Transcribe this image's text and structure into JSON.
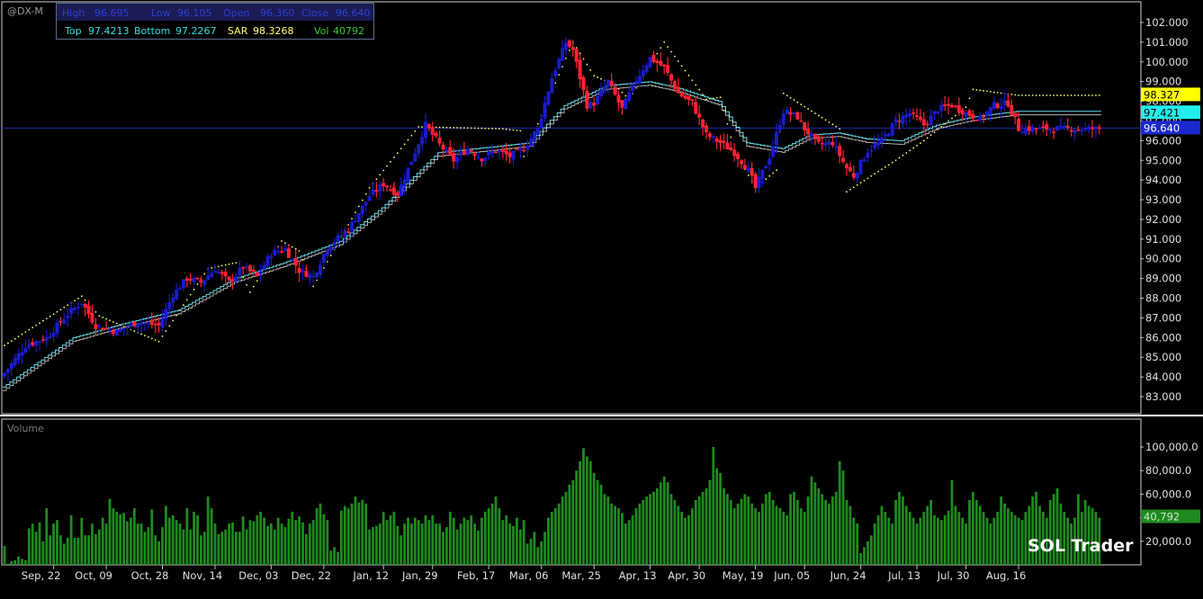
{
  "header": {
    "symbol": "@DX-M",
    "high_label": "High",
    "high_value": "96.695",
    "low_label": "Low",
    "low_value": "96.105",
    "open_label": "Open",
    "open_value": "96.360",
    "close_label": "Close",
    "close_value": "96.640",
    "top_label": "Top",
    "top_value": "97.4213",
    "bottom_label": "Bottom",
    "bottom_value": "97.2267",
    "sar_label": "SAR",
    "sar_value": "98.3268",
    "vol_label": "Vol",
    "vol_value": "40792"
  },
  "watermark": "SOL Trader",
  "colors": {
    "background": "#000000",
    "up_bar": "#1a1acc",
    "down_bar": "#ff2233",
    "band": "#66ddee",
    "sar": "#ffff66",
    "volume": "#1f8a1f",
    "price_line": "#1a2aaa"
  },
  "chart_data": [
    {
      "type": "candlestick",
      "name": "@DX-M",
      "ylim": [
        82.5,
        102.5
      ],
      "yticks": [
        "83.000",
        "84.000",
        "85.000",
        "86.000",
        "87.000",
        "88.000",
        "89.000",
        "90.000",
        "91.000",
        "92.000",
        "93.000",
        "94.000",
        "95.000",
        "96.000",
        "97.000",
        "98.000",
        "99.000",
        "100.000",
        "101.000",
        "102.000"
      ],
      "xticks": [
        "Sep, 22",
        "Oct, 09",
        "Oct, 28",
        "Nov, 14",
        "Dec, 03",
        "Dec, 22",
        "Jan, 12",
        "Jan, 29",
        "Feb, 17",
        "Mar, 06",
        "Mar, 25",
        "Apr, 13",
        "Apr, 30",
        "May, 19",
        "Jun, 05",
        "Jun, 24",
        "Jul, 13",
        "Jul, 30",
        "Aug, 16"
      ],
      "xtick_index": [
        14,
        29,
        45,
        60,
        76,
        91,
        108,
        122,
        138,
        153,
        168,
        184,
        198,
        214,
        228,
        244,
        260,
        274,
        289
      ],
      "last_price_label": "96.640",
      "sar_label": "98.327",
      "band_label": "97.421",
      "close_anchors": [
        [
          0,
          84.2
        ],
        [
          6,
          85.6
        ],
        [
          12,
          86.0
        ],
        [
          18,
          87.2
        ],
        [
          22,
          87.8
        ],
        [
          26,
          86.6
        ],
        [
          32,
          86.3
        ],
        [
          38,
          86.8
        ],
        [
          44,
          86.6
        ],
        [
          48,
          88.2
        ],
        [
          52,
          89.0
        ],
        [
          56,
          88.8
        ],
        [
          60,
          89.5
        ],
        [
          64,
          88.8
        ],
        [
          68,
          89.6
        ],
        [
          72,
          89.1
        ],
        [
          76,
          90.3
        ],
        [
          80,
          90.5
        ],
        [
          84,
          89.4
        ],
        [
          88,
          89.1
        ],
        [
          92,
          90.6
        ],
        [
          98,
          91.5
        ],
        [
          104,
          93.2
        ],
        [
          108,
          93.8
        ],
        [
          112,
          93.3
        ],
        [
          116,
          95.0
        ],
        [
          120,
          96.8
        ],
        [
          124,
          95.8
        ],
        [
          128,
          95.0
        ],
        [
          132,
          95.6
        ],
        [
          136,
          95.1
        ],
        [
          140,
          95.5
        ],
        [
          144,
          95.2
        ],
        [
          148,
          95.6
        ],
        [
          152,
          96.6
        ],
        [
          156,
          99.2
        ],
        [
          160,
          101.0
        ],
        [
          162,
          100.6
        ],
        [
          164,
          99.2
        ],
        [
          166,
          97.8
        ],
        [
          168,
          97.9
        ],
        [
          172,
          99.0
        ],
        [
          176,
          97.6
        ],
        [
          180,
          99.1
        ],
        [
          184,
          100.2
        ],
        [
          188,
          99.7
        ],
        [
          192,
          98.4
        ],
        [
          196,
          97.9
        ],
        [
          200,
          96.3
        ],
        [
          204,
          95.9
        ],
        [
          208,
          95.4
        ],
        [
          212,
          94.5
        ],
        [
          214,
          93.6
        ],
        [
          218,
          95.2
        ],
        [
          222,
          97.5
        ],
        [
          226,
          97.2
        ],
        [
          228,
          96.6
        ],
        [
          232,
          95.8
        ],
        [
          236,
          95.9
        ],
        [
          240,
          94.6
        ],
        [
          242,
          94.2
        ],
        [
          246,
          95.5
        ],
        [
          250,
          96.0
        ],
        [
          254,
          97.0
        ],
        [
          258,
          97.4
        ],
        [
          262,
          96.8
        ],
        [
          266,
          97.6
        ],
        [
          270,
          97.8
        ],
        [
          274,
          97.4
        ],
        [
          278,
          97.1
        ],
        [
          282,
          97.8
        ],
        [
          286,
          97.9
        ],
        [
          289,
          96.6
        ]
      ],
      "sar_anchors": [
        [
          0,
          85.6
        ],
        [
          22,
          88.1
        ],
        [
          27,
          87.1
        ],
        [
          40,
          86.1
        ],
        [
          44,
          85.8
        ],
        [
          58,
          89.5
        ],
        [
          66,
          89.8
        ],
        [
          70,
          88.3
        ],
        [
          79,
          90.9
        ],
        [
          84,
          90.4
        ],
        [
          88,
          88.6
        ],
        [
          104,
          93.6
        ],
        [
          118,
          96.7
        ],
        [
          142,
          96.6
        ],
        [
          147,
          96.5
        ],
        [
          148,
          95.2
        ],
        [
          162,
          101.0
        ],
        [
          168,
          99.3
        ],
        [
          174,
          98.8
        ],
        [
          178,
          98.1
        ],
        [
          188,
          101.0
        ],
        [
          200,
          98.1
        ],
        [
          204,
          98.2
        ],
        [
          208,
          95.5
        ],
        [
          214,
          93.6
        ],
        [
          220,
          94.5
        ],
        [
          222,
          98.4
        ],
        [
          238,
          96.6
        ],
        [
          240,
          93.4
        ],
        [
          254,
          95.0
        ],
        [
          262,
          96.0
        ],
        [
          274,
          97.7
        ],
        [
          276,
          98.6
        ],
        [
          289,
          98.3
        ]
      ],
      "band_anchors": [
        [
          0,
          83.4
        ],
        [
          20,
          85.9
        ],
        [
          34,
          86.6
        ],
        [
          50,
          87.3
        ],
        [
          66,
          88.9
        ],
        [
          80,
          89.7
        ],
        [
          96,
          90.8
        ],
        [
          108,
          92.5
        ],
        [
          124,
          95.3
        ],
        [
          140,
          95.6
        ],
        [
          150,
          95.8
        ],
        [
          160,
          97.7
        ],
        [
          172,
          98.7
        ],
        [
          184,
          98.9
        ],
        [
          192,
          98.6
        ],
        [
          204,
          97.9
        ],
        [
          212,
          95.8
        ],
        [
          222,
          95.5
        ],
        [
          230,
          96.2
        ],
        [
          238,
          96.3
        ],
        [
          246,
          96.0
        ],
        [
          256,
          95.9
        ],
        [
          266,
          96.7
        ],
        [
          276,
          97.1
        ],
        [
          289,
          97.4
        ]
      ]
    },
    {
      "type": "bar",
      "title": "Volume",
      "ylim": [
        0,
        115000
      ],
      "yticks": [
        "20,000.0",
        "40,000.0",
        "60,000.0",
        "80,000.0",
        "100,000.0"
      ],
      "last_value_label": "40,792",
      "values": [
        16000,
        1000,
        3000,
        4000,
        7000,
        5000,
        4000,
        31000,
        35000,
        28000,
        36000,
        20000,
        48000,
        25000,
        35000,
        38000,
        25000,
        18000,
        23000,
        42000,
        23000,
        23000,
        40000,
        25000,
        25000,
        35000,
        26000,
        30000,
        40000,
        35000,
        56000,
        48000,
        45000,
        43000,
        44000,
        37000,
        40000,
        48000,
        35000,
        35000,
        28000,
        32000,
        47000,
        25000,
        20000,
        32000,
        50000,
        40000,
        42000,
        38000,
        35000,
        30000,
        48000,
        30000,
        45000,
        42000,
        25000,
        28000,
        58000,
        48000,
        35000,
        26000,
        28000,
        30000,
        35000,
        36000,
        28000,
        28000,
        41000,
        30000,
        38000,
        37000,
        42000,
        45000,
        40000,
        33000,
        35000,
        30000,
        40000,
        35000,
        32000,
        39000,
        45000,
        38000,
        41000,
        36000,
        26000,
        35000,
        38000,
        48000,
        52000,
        43000,
        38000,
        12000,
        15000,
        11000,
        46000,
        50000,
        48000,
        52000,
        58000,
        53000,
        55000,
        52000,
        30000,
        32000,
        33000,
        35000,
        45000,
        38000,
        42000,
        45000,
        33000,
        25000,
        35000,
        40000,
        35000,
        40000,
        38000,
        35000,
        42000,
        38000,
        42000,
        35000,
        35000,
        28000,
        32000,
        45000,
        40000,
        30000,
        35000,
        40000,
        38000,
        42000,
        35000,
        29000,
        40000,
        45000,
        48000,
        52000,
        58000,
        48000,
        38000,
        42000,
        35000,
        33000,
        40000,
        30000,
        38000,
        18000,
        22000,
        28000,
        15000,
        20000,
        28000,
        40000,
        45000,
        48000,
        52000,
        58000,
        62000,
        68000,
        72000,
        80000,
        88000,
        99000,
        92000,
        88000,
        78000,
        72000,
        68000,
        60000,
        58000,
        52000,
        50000,
        48000,
        44000,
        35000,
        38000,
        42000,
        48000,
        52000,
        55000,
        58000,
        60000,
        62000,
        65000,
        70000,
        75000,
        70000,
        60000,
        55000,
        50000,
        45000,
        40000,
        42000,
        48000,
        55000,
        58000,
        62000,
        65000,
        72000,
        100000,
        82000,
        78000,
        65000,
        60000,
        55000,
        48000,
        52000,
        56000,
        60000,
        58000,
        52000,
        48000,
        45000,
        52000,
        60000,
        62000,
        55000,
        50000,
        48000,
        45000,
        42000,
        60000,
        62000,
        55000,
        48000,
        45000,
        58000,
        75000,
        70000,
        65000,
        60000,
        55000,
        52000,
        58000,
        62000,
        88000,
        80000,
        55000,
        50000,
        40000,
        35000,
        10000,
        15000,
        20000,
        25000,
        35000,
        42000,
        50000,
        45000,
        40000,
        35000,
        55000,
        62000,
        58000,
        50000,
        45000,
        40000,
        35000,
        40000,
        45000,
        50000,
        55000,
        42000,
        40000,
        38000,
        42000,
        46000,
        72000,
        50000,
        45000,
        40000,
        35000,
        55000,
        62000,
        55000,
        50000,
        45000,
        40000,
        35000,
        40000,
        45000,
        58000,
        52000,
        48000,
        45000,
        42000,
        40000,
        38000,
        45000,
        50000,
        58000,
        62000,
        50000,
        45000,
        40000,
        55000,
        60000,
        65000,
        52000,
        45000,
        40000,
        35000,
        40000,
        60000,
        45000,
        55000,
        50000,
        48000,
        45000,
        40000
      ]
    }
  ]
}
